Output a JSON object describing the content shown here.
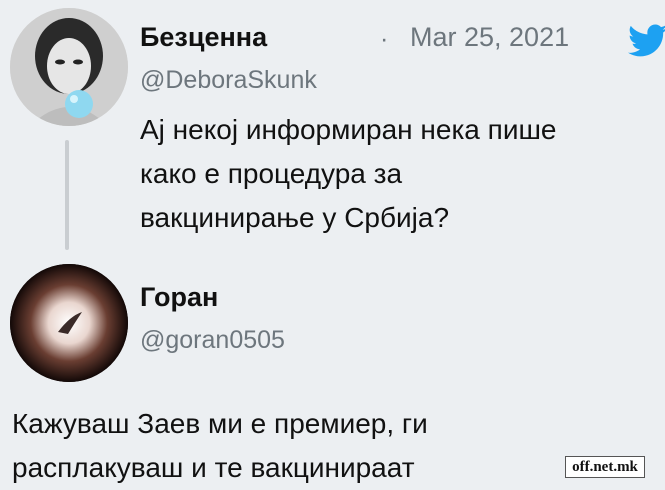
{
  "tweet1": {
    "name": "Безценна",
    "separator": "·",
    "date": "Mar 25, 2021",
    "handle": "@DeboraSkunk",
    "lines": [
      "Ај некој информиран нека пише",
      "како е процедура за",
      "вакцинирање у Србија?"
    ]
  },
  "tweet2": {
    "name": "Горан",
    "handle": "@goran0505",
    "lines": [
      "Кажуваш Заев ми е премиер, ги",
      "расплакуваш и те вакцинираат"
    ]
  },
  "icons": {
    "brand": "twitter-bird-icon",
    "brand_color": "#1da1f2"
  },
  "watermark": "off.net.mk"
}
